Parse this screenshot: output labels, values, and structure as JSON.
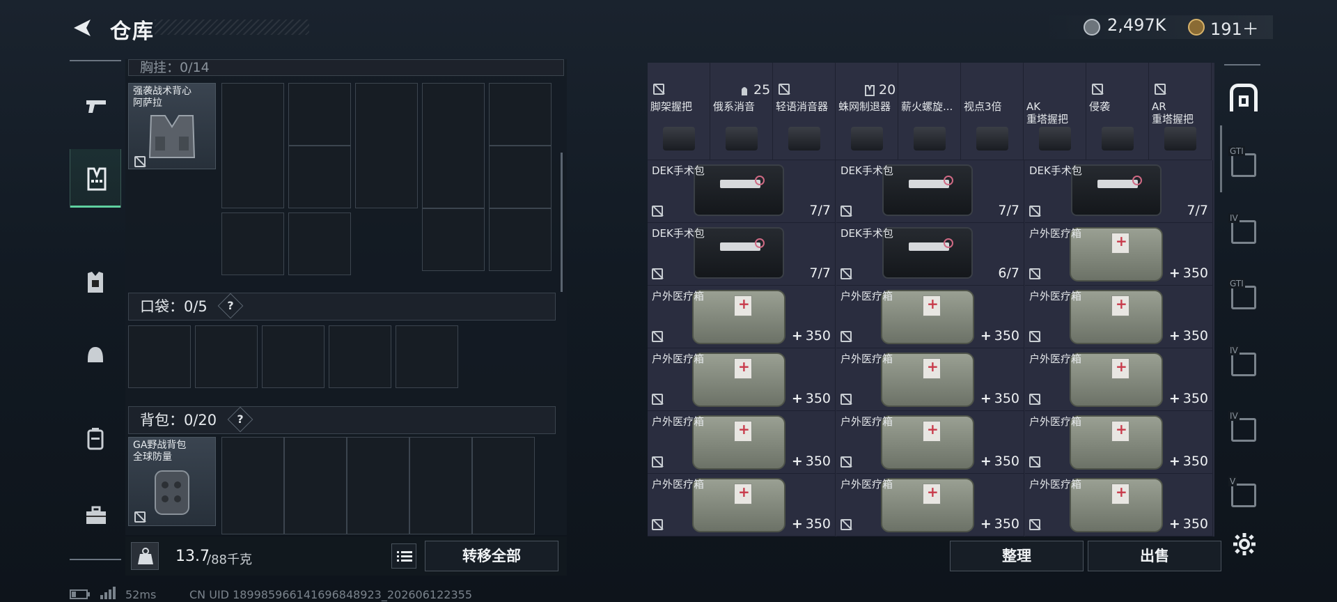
{
  "header": {
    "title": "仓库",
    "currency1": "2,497K",
    "currency2": "191＋"
  },
  "left_nav": [
    {
      "icon": "pistol-icon"
    },
    {
      "icon": "vest-icon",
      "active": true
    },
    {
      "icon": "armor-icon"
    },
    {
      "icon": "helmet-icon"
    },
    {
      "icon": "backpack-icon"
    },
    {
      "icon": "toolbox-icon"
    }
  ],
  "left_panel": {
    "chest_section": "胸挂：0/14",
    "chest_item": {
      "line1": "强袭战术背心",
      "line2": "阿萨拉"
    },
    "pocket_section": "口袋：",
    "pocket_value": "0/5",
    "backpack_section": "背包：",
    "backpack_value": "0/20",
    "backpack_item": {
      "line1": "GA野战背包",
      "line2": "全球防量"
    },
    "question_mark": "?"
  },
  "bottom_left": {
    "weight": "13.7",
    "weight_max": "/88千克",
    "transfer_all": "转移全部"
  },
  "right_panel": {
    "attachments": [
      {
        "line1": "脚架握把",
        "line2": ""
      },
      {
        "line1": "俄系消音",
        "line2": ""
      },
      {
        "line1": "轻语消音器",
        "line2": ""
      },
      {
        "line1": "蛛网制退器",
        "line2": ""
      },
      {
        "line1": "薪火螺旋...",
        "line2": ""
      },
      {
        "line1": "视点3倍",
        "line2": ""
      },
      {
        "line1": "AK",
        "line2": "重塔握把"
      },
      {
        "line1": "侵袭",
        "line2": ""
      },
      {
        "line1": "AR",
        "line2": "重塔握把"
      }
    ],
    "top_counts": {
      "a": "25",
      "b": "20"
    },
    "grid": [
      [
        {
          "name": "DEK手术包",
          "count": "7/7",
          "kind": "medkit"
        },
        {
          "name": "DEK手术包",
          "count": "7/7",
          "kind": "medkit"
        },
        {
          "name": "DEK手术包",
          "count": "7/7",
          "kind": "medkit"
        }
      ],
      [
        {
          "name": "DEK手术包",
          "count": "7/7",
          "kind": "medkit"
        },
        {
          "name": "DEK手术包",
          "count": "6/7",
          "kind": "medkit"
        },
        {
          "name": "户外医疗箱",
          "count": "350",
          "kind": "bag"
        }
      ],
      [
        {
          "name": "户外医疗箱",
          "count": "350",
          "kind": "bag"
        },
        {
          "name": "户外医疗箱",
          "count": "350",
          "kind": "bag"
        },
        {
          "name": "户外医疗箱",
          "count": "350",
          "kind": "bag"
        }
      ],
      [
        {
          "name": "户外医疗箱",
          "count": "350",
          "kind": "bag"
        },
        {
          "name": "户外医疗箱",
          "count": "350",
          "kind": "bag"
        },
        {
          "name": "户外医疗箱",
          "count": "350",
          "kind": "bag"
        }
      ],
      [
        {
          "name": "户外医疗箱",
          "count": "350",
          "kind": "bag"
        },
        {
          "name": "户外医疗箱",
          "count": "350",
          "kind": "bag"
        },
        {
          "name": "户外医疗箱",
          "count": "350",
          "kind": "bag"
        }
      ],
      [
        {
          "name": "户外医疗箱",
          "count": "350",
          "kind": "bag"
        },
        {
          "name": "户外医疗箱",
          "count": "350",
          "kind": "bag"
        },
        {
          "name": "户外医疗箱",
          "count": "350",
          "kind": "bag"
        }
      ]
    ],
    "sort_button": "整理",
    "sell_button": "出售"
  },
  "right_nav": [
    {
      "icon": "storage-icon",
      "tag": ""
    },
    {
      "icon": "storage-tier-icon",
      "tag": "GTI"
    },
    {
      "icon": "storage-tier-icon",
      "tag": "IV"
    },
    {
      "icon": "storage-tier-icon",
      "tag": "GTI"
    },
    {
      "icon": "storage-tier-icon",
      "tag": "IV"
    },
    {
      "icon": "storage-tier-icon",
      "tag": "IV"
    },
    {
      "icon": "storage-tier-icon",
      "tag": "V"
    }
  ],
  "status": {
    "ping": "52ms",
    "uid": "CN UID 18998596614169684​8923_202606122355"
  }
}
